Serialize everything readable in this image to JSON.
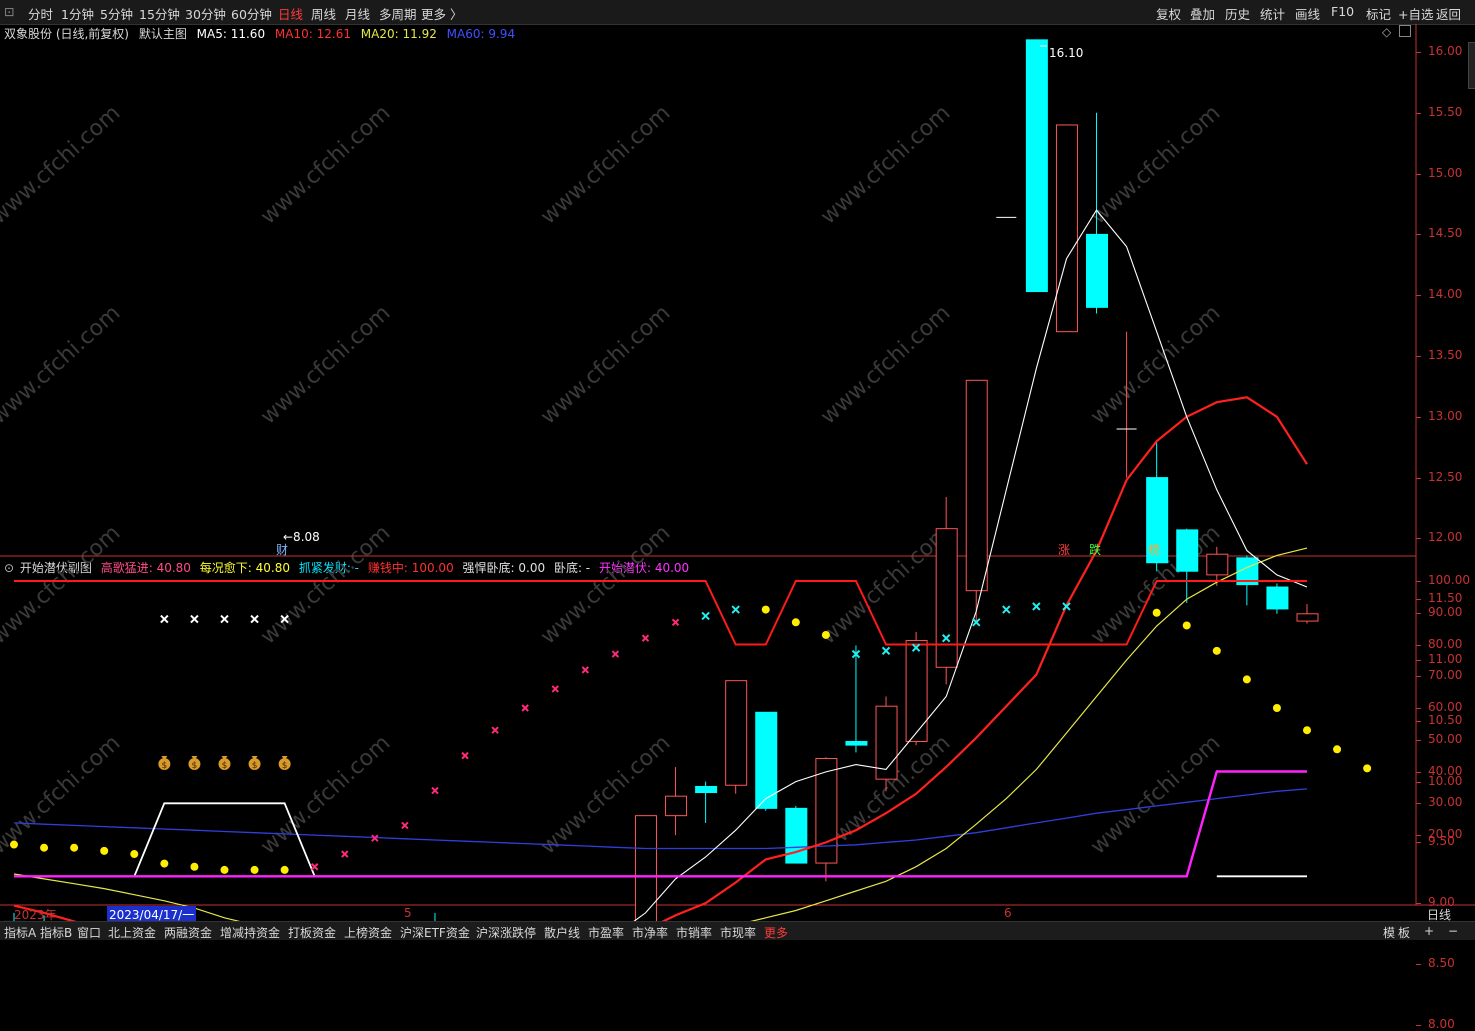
{
  "toolbar": {
    "periods": [
      "分时",
      "1分钟",
      "5分钟",
      "15分钟",
      "30分钟",
      "60分钟",
      "日线",
      "周线",
      "月线",
      "多周期",
      "更多 〉"
    ],
    "active_period": "日线",
    "right_buttons": [
      "复权",
      "叠加",
      "历史",
      "统计",
      "画线",
      "F10",
      "标记",
      "+自选",
      "返回"
    ]
  },
  "main_info": {
    "stock": "双象股份 (日线,前复权)",
    "chart_name": "默认主图",
    "ma5": "MA5: 11.60",
    "ma10": "MA10: 12.61",
    "ma20": "MA20: 11.92",
    "ma60": "MA60: 9.94"
  },
  "sub_info": {
    "name": "开始潜伏副图",
    "l1": "高歌猛进: 40.80",
    "l2": "每况愈下: 40.80",
    "l3": "抓紧发财: -",
    "l4": "赚钱中: 100.00",
    "l5": "强悍卧底: 0.00",
    "l6": "卧底: -",
    "l7": "开始潜伏: 40.00"
  },
  "annotations": {
    "high": "16.10",
    "low": "←8.08",
    "cai": "财",
    "zhang": "涨",
    "die": "跌",
    "bang": "榜"
  },
  "colors": {
    "up": "#ff5555",
    "down": "#00ffff",
    "ma5": "#ffffff",
    "ma10": "#ff2020",
    "ma20": "#e6e64a",
    "ma60": "#2f3fdc",
    "axis": "#c83232"
  },
  "main_axis_ticks": [
    "16.00",
    "15.50",
    "15.00",
    "14.50",
    "14.00",
    "13.50",
    "13.00",
    "12.50",
    "12.00",
    "11.50",
    "11.00",
    "10.50",
    "10.00",
    "9.50",
    "9.00",
    "8.50",
    "8.00"
  ],
  "sub_axis_ticks": [
    "100.00",
    "90.00",
    "80.00",
    "70.00",
    "60.00",
    "50.00",
    "40.00",
    "30.00",
    "20.00"
  ],
  "x_axis": {
    "year": "2023年",
    "cursor_date": "2023/04/17/一",
    "m5": "5",
    "m6": "6",
    "period_label": "日线"
  },
  "chart_data": {
    "type": "candlestick",
    "ylim": [
      7.8,
      16.3
    ],
    "candles": [
      {
        "o": 8.85,
        "c": 8.79,
        "h": 8.92,
        "l": 8.75
      },
      {
        "o": 8.82,
        "c": 8.78,
        "h": 8.9,
        "l": 8.74
      },
      {
        "o": 8.78,
        "c": 8.8,
        "h": 8.85,
        "l": 8.75
      },
      {
        "o": 8.79,
        "c": 8.77,
        "h": 8.84,
        "l": 8.74
      },
      {
        "o": 8.74,
        "c": 8.66,
        "h": 8.78,
        "l": 8.62
      },
      {
        "o": 8.63,
        "c": 8.58,
        "h": 8.67,
        "l": 8.56
      },
      {
        "o": 8.55,
        "c": 8.54,
        "h": 8.59,
        "l": 8.4
      },
      {
        "o": 8.58,
        "c": 8.28,
        "h": 8.6,
        "l": 8.24
      },
      {
        "o": 8.24,
        "c": 8.22,
        "h": 8.3,
        "l": 8.14
      },
      {
        "o": 8.26,
        "c": 8.22,
        "h": 8.32,
        "l": 8.08
      },
      {
        "o": 8.12,
        "c": 8.44,
        "h": 8.48,
        "l": 8.08
      },
      {
        "o": 8.45,
        "c": 8.5,
        "h": 8.55,
        "l": 8.4
      },
      {
        "o": 8.48,
        "c": 8.61,
        "h": 8.64,
        "l": 8.46
      },
      {
        "o": 8.74,
        "c": 8.8,
        "h": 8.82,
        "l": 8.7
      },
      {
        "o": 8.82,
        "c": 8.8,
        "h": 8.92,
        "l": 8.74
      },
      {
        "o": 8.78,
        "c": 8.82,
        "h": 8.85,
        "l": 8.74
      },
      {
        "o": 8.8,
        "c": 8.62,
        "h": 8.82,
        "l": 8.6
      },
      {
        "o": 8.72,
        "c": 8.74,
        "h": 8.78,
        "l": 8.66
      },
      {
        "o": 8.75,
        "c": 8.78,
        "h": 8.82,
        "l": 8.72
      },
      {
        "o": 8.79,
        "c": 8.73,
        "h": 8.84,
        "l": 8.7
      },
      {
        "o": 8.74,
        "c": 8.74,
        "h": 8.78,
        "l": 8.68
      },
      {
        "o": 8.74,
        "c": 9.72,
        "h": 9.72,
        "l": 8.7
      },
      {
        "o": 9.72,
        "c": 9.88,
        "h": 10.12,
        "l": 9.56
      },
      {
        "o": 9.96,
        "c": 9.91,
        "h": 10.0,
        "l": 9.66
      },
      {
        "o": 9.97,
        "c": 10.83,
        "h": 10.83,
        "l": 9.9
      },
      {
        "o": 10.57,
        "c": 9.78,
        "h": 10.57,
        "l": 9.76
      },
      {
        "o": 9.78,
        "c": 9.33,
        "h": 9.8,
        "l": 9.33
      },
      {
        "o": 9.33,
        "c": 10.19,
        "h": 10.2,
        "l": 9.18
      },
      {
        "o": 10.33,
        "c": 10.3,
        "h": 11.12,
        "l": 10.24
      },
      {
        "o": 10.02,
        "c": 10.62,
        "h": 10.7,
        "l": 9.92
      },
      {
        "o": 10.33,
        "c": 11.16,
        "h": 11.23,
        "l": 10.3
      },
      {
        "o": 10.94,
        "c": 12.08,
        "h": 12.34,
        "l": 10.8
      },
      {
        "o": 11.57,
        "c": 13.3,
        "h": 13.3,
        "l": 11.3
      },
      {
        "o": 14.64,
        "c": 14.64,
        "h": 14.64,
        "l": 14.64
      },
      {
        "o": 16.1,
        "c": 14.03,
        "h": 16.1,
        "l": 14.03
      },
      {
        "o": 13.7,
        "c": 15.4,
        "h": 15.4,
        "l": 13.7
      },
      {
        "o": 14.5,
        "c": 13.9,
        "h": 15.5,
        "l": 13.85
      },
      {
        "o": 12.9,
        "c": 12.9,
        "h": 13.7,
        "l": 12.5
      },
      {
        "o": 12.5,
        "c": 11.8,
        "h": 12.8,
        "l": 11.73
      },
      {
        "o": 12.07,
        "c": 11.73,
        "h": 12.08,
        "l": 11.47
      },
      {
        "o": 11.7,
        "c": 11.87,
        "h": 11.93,
        "l": 11.61
      },
      {
        "o": 11.84,
        "c": 11.62,
        "h": 11.86,
        "l": 11.45
      },
      {
        "o": 11.6,
        "c": 11.42,
        "h": 11.63,
        "l": 11.38
      },
      {
        "o": 11.32,
        "c": 11.38,
        "h": 11.46,
        "l": 11.3
      }
    ],
    "ma5": [
      null,
      null,
      null,
      null,
      null,
      null,
      null,
      null,
      8.3,
      8.26,
      8.27,
      8.33,
      8.37,
      8.47,
      8.6,
      8.7,
      8.78,
      8.76,
      8.74,
      8.72,
      8.74,
      8.92,
      9.2,
      9.38,
      9.6,
      9.86,
      10.0,
      10.08,
      10.14,
      10.1,
      10.4,
      10.7,
      11.4,
      12.4,
      13.4,
      14.3,
      14.7,
      14.4,
      13.7,
      13.0,
      12.4,
      11.9,
      11.7,
      11.6
    ],
    "ma10": [
      8.98,
      8.92,
      8.85,
      8.79,
      8.75,
      8.71,
      8.66,
      8.59,
      8.54,
      8.49,
      8.48,
      8.48,
      8.49,
      8.51,
      8.53,
      8.55,
      8.57,
      8.6,
      8.62,
      8.64,
      8.68,
      8.78,
      8.9,
      9.0,
      9.17,
      9.36,
      9.42,
      9.5,
      9.6,
      9.74,
      9.9,
      10.12,
      10.36,
      10.62,
      10.88,
      11.45,
      11.9,
      12.48,
      12.8,
      13.0,
      13.12,
      13.16,
      13.0,
      12.61
    ],
    "ma20": [
      9.24,
      9.2,
      9.16,
      9.12,
      9.07,
      9.02,
      8.96,
      8.88,
      8.82,
      8.75,
      8.68,
      8.66,
      8.64,
      8.63,
      8.62,
      8.61,
      8.6,
      8.6,
      8.6,
      8.61,
      8.62,
      8.64,
      8.7,
      8.76,
      8.82,
      8.88,
      8.94,
      9.02,
      9.1,
      9.18,
      9.3,
      9.45,
      9.65,
      9.86,
      10.1,
      10.4,
      10.7,
      11.0,
      11.28,
      11.5,
      11.64,
      11.76,
      11.86,
      11.92
    ],
    "ma60": [
      9.66,
      9.65,
      9.64,
      9.63,
      9.62,
      9.61,
      9.6,
      9.59,
      9.58,
      9.57,
      9.56,
      9.55,
      9.54,
      9.53,
      9.52,
      9.51,
      9.5,
      9.49,
      9.48,
      9.47,
      9.46,
      9.45,
      9.45,
      9.45,
      9.45,
      9.45,
      9.46,
      9.47,
      9.48,
      9.5,
      9.52,
      9.55,
      9.58,
      9.62,
      9.66,
      9.7,
      9.74,
      9.77,
      9.8,
      9.83,
      9.86,
      9.89,
      9.92,
      9.94
    ],
    "sub_ylim": [
      5,
      102
    ],
    "sub_red_line": [
      100,
      100,
      100,
      100,
      100,
      100,
      100,
      100,
      100,
      100,
      100,
      100,
      100,
      100,
      100,
      100,
      100,
      100,
      100,
      100,
      100,
      100,
      100,
      100,
      80,
      80,
      100,
      100,
      100,
      80,
      80,
      80,
      80,
      80,
      80,
      80,
      80,
      80,
      100,
      100,
      100,
      100,
      100,
      100
    ],
    "sub_magenta_line": [
      7,
      7,
      7,
      7,
      7,
      7,
      7,
      7,
      7,
      7,
      7,
      7,
      7,
      7,
      7,
      7,
      7,
      7,
      7,
      7,
      7,
      7,
      7,
      7,
      7,
      7,
      7,
      7,
      7,
      7,
      7,
      7,
      7,
      7,
      7,
      7,
      7,
      7,
      7,
      7,
      40,
      40,
      40,
      40
    ],
    "sub_white_line": [
      null,
      null,
      null,
      null,
      7,
      30,
      30,
      30,
      30,
      30,
      7,
      null,
      null,
      null,
      null,
      null,
      null,
      null,
      null,
      null,
      null,
      null,
      null,
      null,
      null,
      null,
      null,
      null,
      null,
      null,
      null,
      null,
      null,
      null,
      null,
      null,
      null,
      null,
      null,
      null,
      7,
      7,
      7,
      7
    ],
    "sub_yellow_dots": [
      17,
      16,
      16,
      15,
      14,
      11,
      10,
      9,
      9,
      9,
      null,
      null,
      null,
      null,
      null,
      null,
      null,
      null,
      null,
      null,
      null,
      null,
      null,
      null,
      null,
      91,
      87,
      83,
      null,
      null,
      null,
      null,
      null,
      null,
      null,
      null,
      null,
      null,
      90,
      86,
      78,
      69,
      60,
      53,
      47,
      41
    ],
    "sub_pink_x": [
      null,
      null,
      null,
      null,
      null,
      null,
      null,
      null,
      null,
      null,
      10,
      14,
      19,
      23,
      34,
      45,
      53,
      60,
      66,
      72,
      77,
      82,
      87,
      null,
      null,
      null,
      null,
      null,
      null,
      null,
      null,
      null,
      null,
      null,
      null,
      null,
      null,
      null,
      null,
      null,
      null,
      null,
      null,
      null
    ],
    "sub_cyan_x": [
      null,
      null,
      null,
      null,
      null,
      null,
      null,
      null,
      null,
      null,
      null,
      null,
      null,
      null,
      null,
      null,
      null,
      null,
      null,
      null,
      null,
      null,
      null,
      89,
      91,
      null,
      null,
      null,
      77,
      78,
      79,
      82,
      87,
      91,
      92,
      92,
      null,
      null,
      null,
      null,
      null,
      null,
      null,
      null
    ],
    "sub_white_x": [
      null,
      null,
      null,
      null,
      null,
      88,
      88,
      88,
      88,
      88,
      null,
      null,
      null,
      null,
      null,
      null,
      null,
      null,
      null,
      null,
      null,
      null,
      null,
      null,
      null,
      null,
      null,
      null,
      null,
      null,
      null,
      null,
      null,
      null,
      null,
      null,
      null,
      null,
      null,
      null,
      null,
      null,
      null,
      null
    ],
    "sub_bags": [
      null,
      null,
      null,
      null,
      null,
      43,
      43,
      43,
      43,
      43,
      null,
      null,
      null,
      null,
      null,
      null,
      null,
      null,
      null,
      null,
      null,
      null,
      null,
      null,
      null,
      null,
      null,
      null,
      null,
      null,
      null,
      null,
      null,
      null,
      null,
      null,
      null,
      null,
      null,
      null,
      null,
      null,
      null,
      null
    ]
  },
  "bottom_tabs": [
    "指标A",
    "指标B",
    "窗口",
    "北上资金",
    "两融资金",
    "增减持资金",
    "打板资金",
    "上榜资金",
    "沪深ETF资金",
    "沪深涨跌停",
    "散户线",
    "市盈率",
    "市净率",
    "市销率",
    "市现率",
    "更多"
  ],
  "bottom_right": [
    "模",
    "板",
    "+",
    "−"
  ],
  "watermark": "www.cfchi.com"
}
